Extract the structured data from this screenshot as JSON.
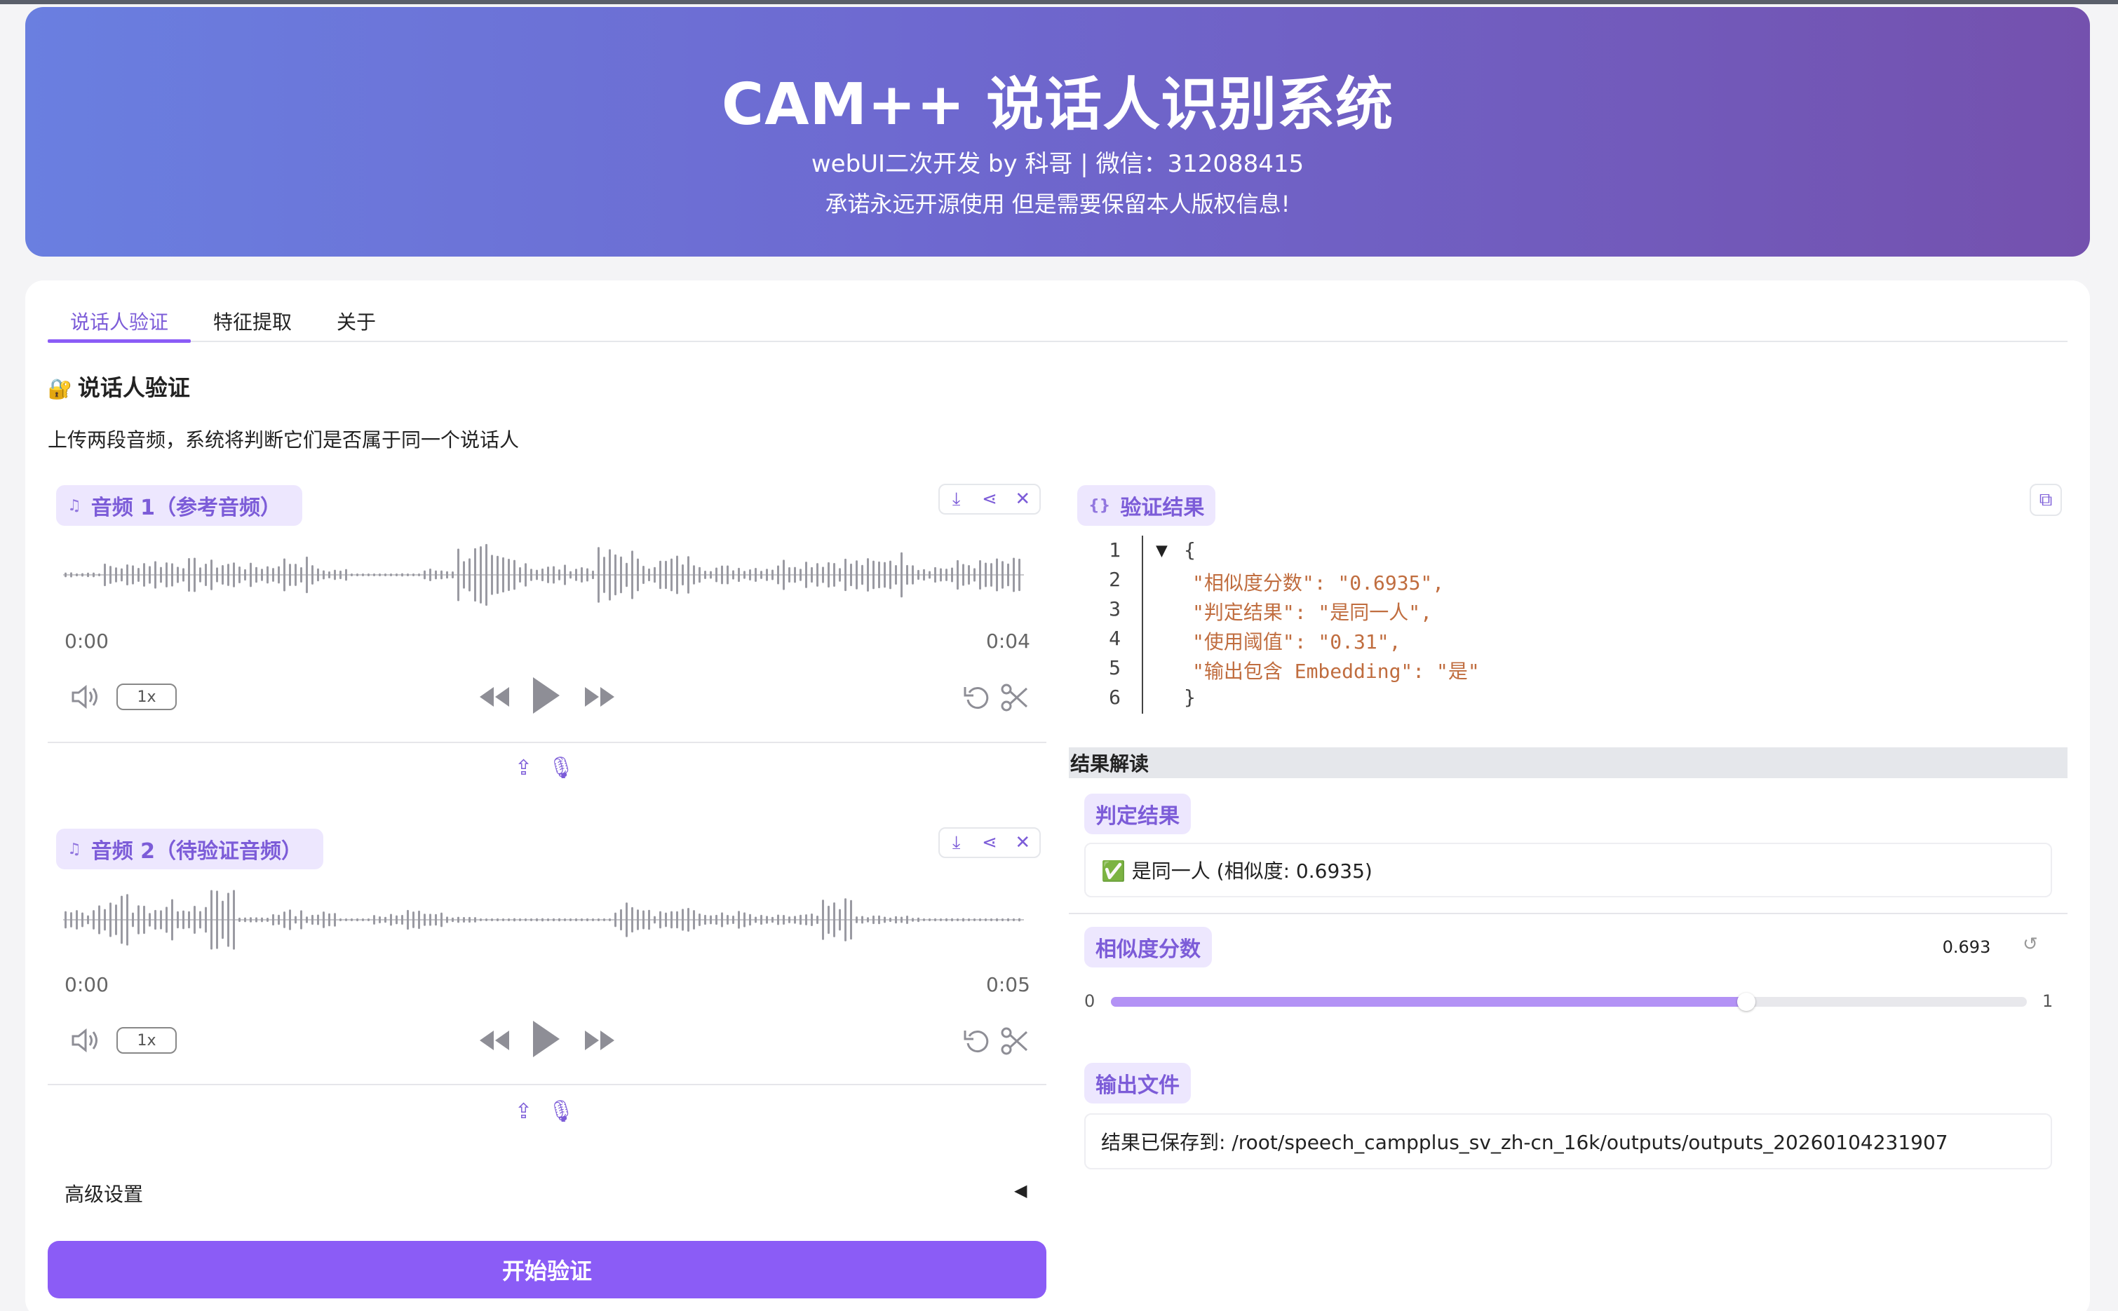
{
  "header": {
    "title": "CAM++ 说话人识别系统",
    "subtitle": "webUI二次开发 by 科哥 | 微信：312088415",
    "notice": "承诺永远开源使用 但是需要保留本人版权信息!"
  },
  "tabs": [
    "说话人验证",
    "特征提取",
    "关于"
  ],
  "section": {
    "title": "说话人验证",
    "description": "上传两段音频，系统将判断它们是否属于同一个说话人"
  },
  "audio1": {
    "label": "音频 1（参考音频）",
    "time_start": "0:00",
    "time_end": "0:04",
    "speed": "1x"
  },
  "audio2": {
    "label": "音频 2（待验证音频）",
    "time_start": "0:00",
    "time_end": "0:05",
    "speed": "1x"
  },
  "advanced": {
    "label": "高级设置"
  },
  "start_button": "开始验证",
  "result": {
    "label": "验证结果",
    "line_numbers": [
      "1",
      "2",
      "3",
      "4",
      "5",
      "6"
    ],
    "json_lines": [
      "{",
      "\"相似度分数\": \"0.6935\",",
      "\"判定结果\": \"是同一人\",",
      "\"使用阈值\": \"0.31\",",
      "\"输出包含 Embedding\": \"是\"",
      "}"
    ]
  },
  "interpretation": {
    "heading": "结果解读",
    "verdict_label": "判定结果",
    "verdict_value": "✅ 是同一人 (相似度: 0.6935)",
    "similarity_label": "相似度分数",
    "similarity_value": "0.693",
    "similarity_fraction": 0.6935,
    "slider_min": "0",
    "slider_max": "1",
    "output_label": "输出文件",
    "output_value": "结果已保存到: /root/speech_campplus_sv_zh-cn_16k/outputs/outputs_20260104231907"
  },
  "colors": {
    "accent": "#8b5cf6",
    "accent_light": "#ede7fe",
    "header_start": "#6a7fe0",
    "header_end": "#7451ae"
  }
}
